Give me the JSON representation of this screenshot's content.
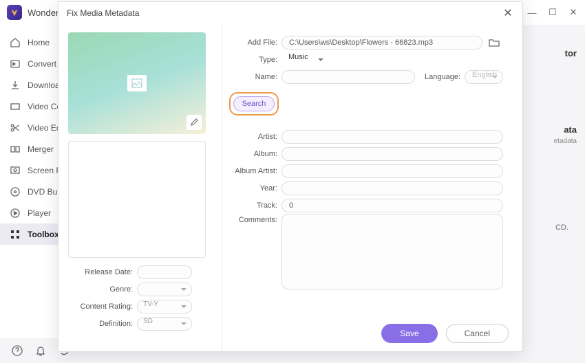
{
  "app": {
    "title": "Wonder"
  },
  "nav": {
    "items": [
      {
        "label": "Home"
      },
      {
        "label": "Convert"
      },
      {
        "label": "Downloa"
      },
      {
        "label": "Video Ce"
      },
      {
        "label": "Video Ed"
      },
      {
        "label": "Merger"
      },
      {
        "label": "Screen R"
      },
      {
        "label": "DVD Bu"
      },
      {
        "label": "Player"
      },
      {
        "label": "Toolbox"
      }
    ]
  },
  "bg": {
    "t1": "tor",
    "t2": "ata",
    "s2": "etadata",
    "cd": "CD."
  },
  "dialog": {
    "title": "Fix Media Metadata",
    "left": {
      "release": "Release Date:",
      "genre": "Genre:",
      "rating": "Content Rating:",
      "rating_val": "TV-Y",
      "definition": "Definition:",
      "definition_val": "SD"
    },
    "form": {
      "addfile_label": "Add File:",
      "addfile_val": "C:\\Users\\ws\\Desktop\\Flowers - 66823.mp3",
      "type_label": "Type:",
      "type_val": "Music",
      "name_label": "Name:",
      "lang_label": "Language:",
      "lang_val": "English",
      "search": "Search",
      "artist": "Artist:",
      "album": "Album:",
      "album_artist": "Album Artist:",
      "year": "Year:",
      "track": "Track:",
      "track_val": "0",
      "comments": "Comments:"
    },
    "footer": {
      "save": "Save",
      "cancel": "Cancel"
    }
  }
}
